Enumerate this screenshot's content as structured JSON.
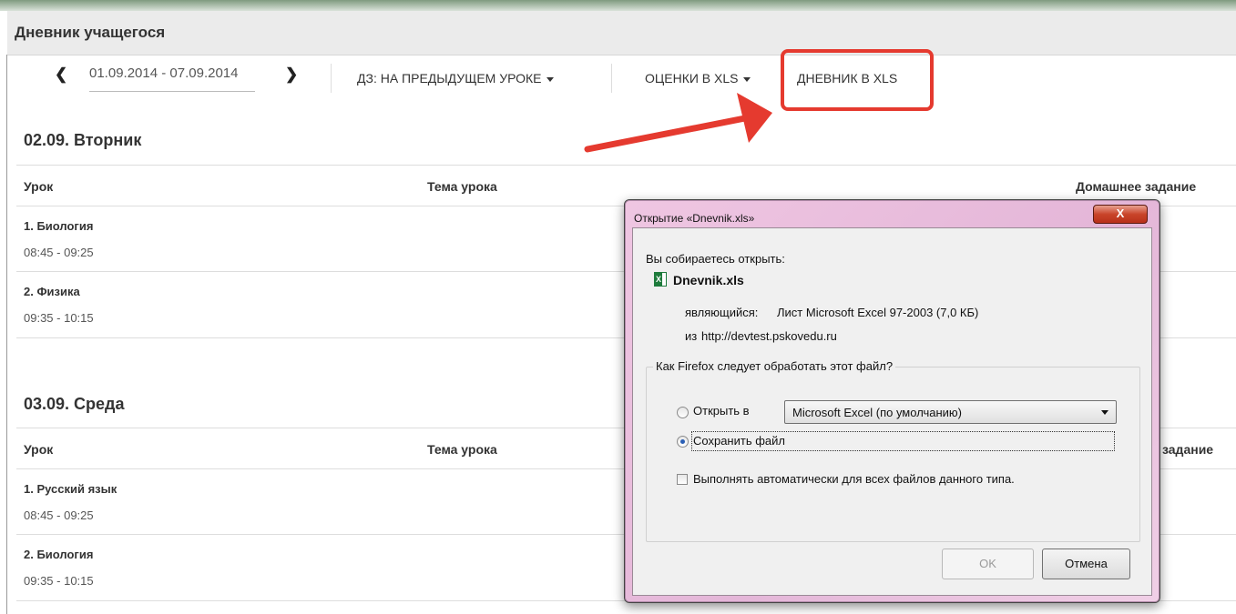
{
  "page": {
    "title": "Дневник учащегося"
  },
  "toolbar": {
    "prev": "❮",
    "next": "❯",
    "date_range": "01.09.2014 - 07.09.2014",
    "homework": "ДЗ: НА ПРЕДЫДУЩЕМ УРОКЕ",
    "grades_xls": "ОЦЕНКИ В XLS",
    "diary_xls": "ДНЕВНИК В XLS"
  },
  "days": [
    {
      "title": "02.09. Вторник",
      "headers": {
        "lesson": "Урок",
        "topic": "Тема урока",
        "homework": "Домашнее задание"
      },
      "lessons": [
        {
          "name": "1. Биология",
          "time": "08:45 - 09:25"
        },
        {
          "name": "2. Физика",
          "time": "09:35 - 10:15"
        }
      ]
    },
    {
      "title": "03.09. Среда",
      "headers": {
        "lesson": "Урок",
        "topic": "Тема урока",
        "homework": "задание"
      },
      "lessons": [
        {
          "name": "1. Русский язык",
          "time": "08:45 - 09:25"
        },
        {
          "name": "2. Биология",
          "time": "09:35 - 10:15"
        }
      ]
    }
  ],
  "dialog": {
    "title": "Открытие «Dnevnik.xls»",
    "close": "X",
    "intro": "Вы собираетесь открыть:",
    "filename": "Dnevnik.xls",
    "type_label": "являющийся:",
    "type_value": "Лист Microsoft Excel 97-2003 (7,0 КБ)",
    "from_label": "из",
    "from_value": "http://devtest.pskovedu.ru",
    "group_label": "Как Firefox следует обработать этот файл?",
    "open_with": "Открыть в",
    "app": "Microsoft Excel (по умолчанию)",
    "save_file": "Сохранить файл",
    "auto": "Выполнять автоматически для всех файлов данного типа.",
    "ok": "OK",
    "cancel": "Отмена"
  },
  "colors": {
    "highlight": "#e53a2f",
    "arrow": "#e53a2f",
    "accent_radio": "#2a5fb5"
  }
}
